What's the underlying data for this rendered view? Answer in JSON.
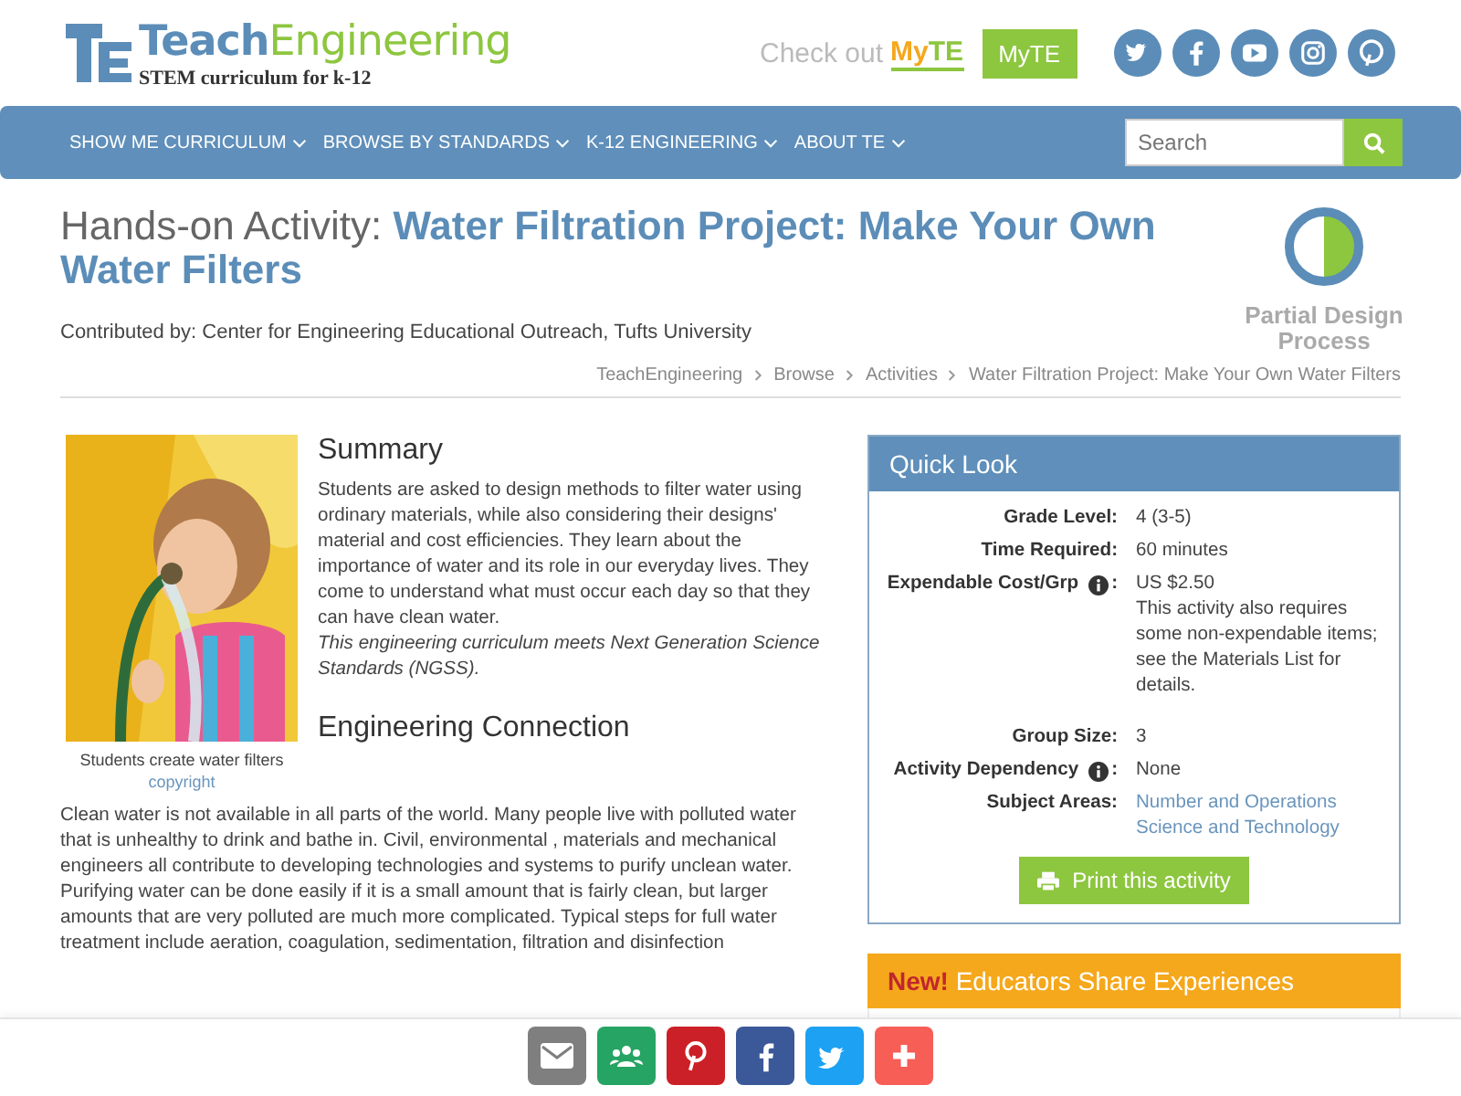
{
  "header": {
    "logo_word_1": "Teach",
    "logo_word_2": "Engineering",
    "tagline": "STEM curriculum for k-12",
    "promo_text": "Check out",
    "promo_logo_1": "My",
    "promo_logo_2": "TE",
    "myte_button": "MyTE",
    "social": [
      {
        "kind": "twitter"
      },
      {
        "kind": "facebook"
      },
      {
        "kind": "youtube"
      },
      {
        "kind": "instagram"
      },
      {
        "kind": "pinterest"
      }
    ]
  },
  "nav": {
    "items": [
      {
        "label": "SHOW ME CURRICULUM"
      },
      {
        "label": "BROWSE BY STANDARDS"
      },
      {
        "label": "K-12 ENGINEERING"
      },
      {
        "label": "ABOUT TE"
      }
    ],
    "search": {
      "placeholder": "Search"
    }
  },
  "title": {
    "prefix": "Hands-on Activity:",
    "name": "Water Filtration Project: Make Your Own Water Filters"
  },
  "contributor": "Contributed by: Center for Engineering Educational Outreach, Tufts University",
  "design_badge": {
    "label": "Partial Design Process",
    "level": 0.5
  },
  "breadcrumbs": [
    "TeachEngineering",
    "Browse",
    "Activities",
    "Water Filtration Project: Make Your Own Water Filters"
  ],
  "figure": {
    "kind": "picture",
    "caption": "Students create water filters",
    "credit": "copyright"
  },
  "summary": {
    "heading": "Summary",
    "text": "Students are asked to design methods to filter water using ordinary materials, while also considering their designs' material and cost efficiencies. They learn about the importance of water and its role in our everyday lives. They come to understand what must occur each day so that they can have clean water.",
    "note": "This engineering curriculum meets Next Generation Science Standards (NGSS)."
  },
  "engineering_connection": {
    "heading": "Engineering Connection",
    "text": "Clean water is not available in all parts of the world. Many people live with polluted water that is unhealthy to drink and bathe in. Civil, environmental , materials and mechanical engineers all contribute to developing technologies and systems to purify unclean water. Purifying water can be done easily if it is a small amount that is fairly clean, but larger amounts that are very polluted are much more complicated. Typical steps for full water treatment include aeration, coagulation, sedimentation, filtration and disinfection"
  },
  "quick_look": {
    "title": "Quick Look",
    "rows": [
      {
        "label": "Grade Level:",
        "info": false,
        "values": [
          "4 (3-5)"
        ],
        "kind": "text"
      },
      {
        "label": "Time Required:",
        "info": false,
        "values": [
          "60 minutes"
        ],
        "kind": "text"
      },
      {
        "label": "Expendable Cost/Grp",
        "info": true,
        "after_icon": ":",
        "values": [
          "US $2.50",
          "This activity also requires some non-expendable items; see the Materials List for details."
        ],
        "kind": "text"
      },
      {
        "label": "Group Size:",
        "info": false,
        "values": [
          "3"
        ],
        "kind": "text"
      },
      {
        "label": "Activity Dependency",
        "info": true,
        "after_icon": ":",
        "values": [
          "None"
        ],
        "kind": "text"
      },
      {
        "label": "Subject Areas:",
        "info": false,
        "values": [
          "Number and Operations",
          "Science and Technology"
        ],
        "kind": "link"
      }
    ],
    "print_button": "Print this activity"
  },
  "educators_panel": {
    "badge": "New!",
    "title": "Educators Share Experiences"
  },
  "share_bar": [
    {
      "kind": "email",
      "color": "#7f7f7f"
    },
    {
      "kind": "classroom",
      "color": "#26a464"
    },
    {
      "kind": "pinterest",
      "color": "#cb2027"
    },
    {
      "kind": "facebook",
      "color": "#3b5998"
    },
    {
      "kind": "twitter",
      "color": "#1da1f2"
    },
    {
      "kind": "more",
      "color": "#f65e56"
    }
  ]
}
